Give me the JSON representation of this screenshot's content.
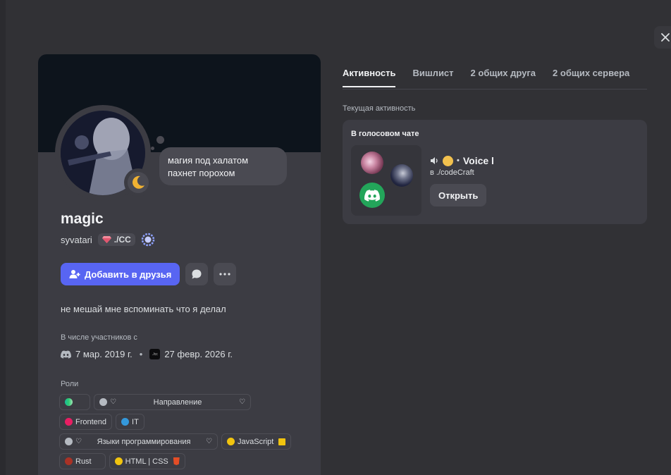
{
  "profile": {
    "display_name": "magic",
    "username": "syvatari",
    "guild_tag": "./CC",
    "status_bubble": "магия под халатом пахнет порохом",
    "bio": "не мешай мне вспоминать что я делал",
    "add_friend_label": "Добавить в друзья",
    "member_since_label": "В числе участников с",
    "discord_date": "7 мар. 2019 г.",
    "server_date": "27 февр. 2026 г.",
    "server_icon_text": "./cc",
    "roles_label": "Роли",
    "roles": {
      "direction": "Направление",
      "frontend": "Frontend",
      "it": "IT",
      "languages": "Языки программирования",
      "javascript": "JavaScript",
      "rust": "Rust",
      "html_css": "HTML | CSS"
    },
    "colors": {
      "add_button": "#5865f2",
      "banner": "#0d141c",
      "frontend": "#e91e63",
      "it": "#3498db",
      "gray_role": "#b5bac1",
      "javascript": "#f1c40f",
      "rust": "#a93226",
      "html_css": "#f1c40f"
    }
  },
  "tabs": [
    "Активность",
    "Вишлист",
    "2 общих друга",
    "2 общих сервера"
  ],
  "activity": {
    "section_label": "Текущая активность",
    "card_title": "В голосовом чате",
    "channel": "Voice l",
    "server": "в ./codeCraft",
    "open_label": "Открыть"
  },
  "icons": {
    "close": "close-icon",
    "add_friend": "add-friend-icon",
    "message": "chat-bubble-icon",
    "more": "more-icon",
    "speaker": "speaker-icon",
    "discord": "discord-icon"
  }
}
